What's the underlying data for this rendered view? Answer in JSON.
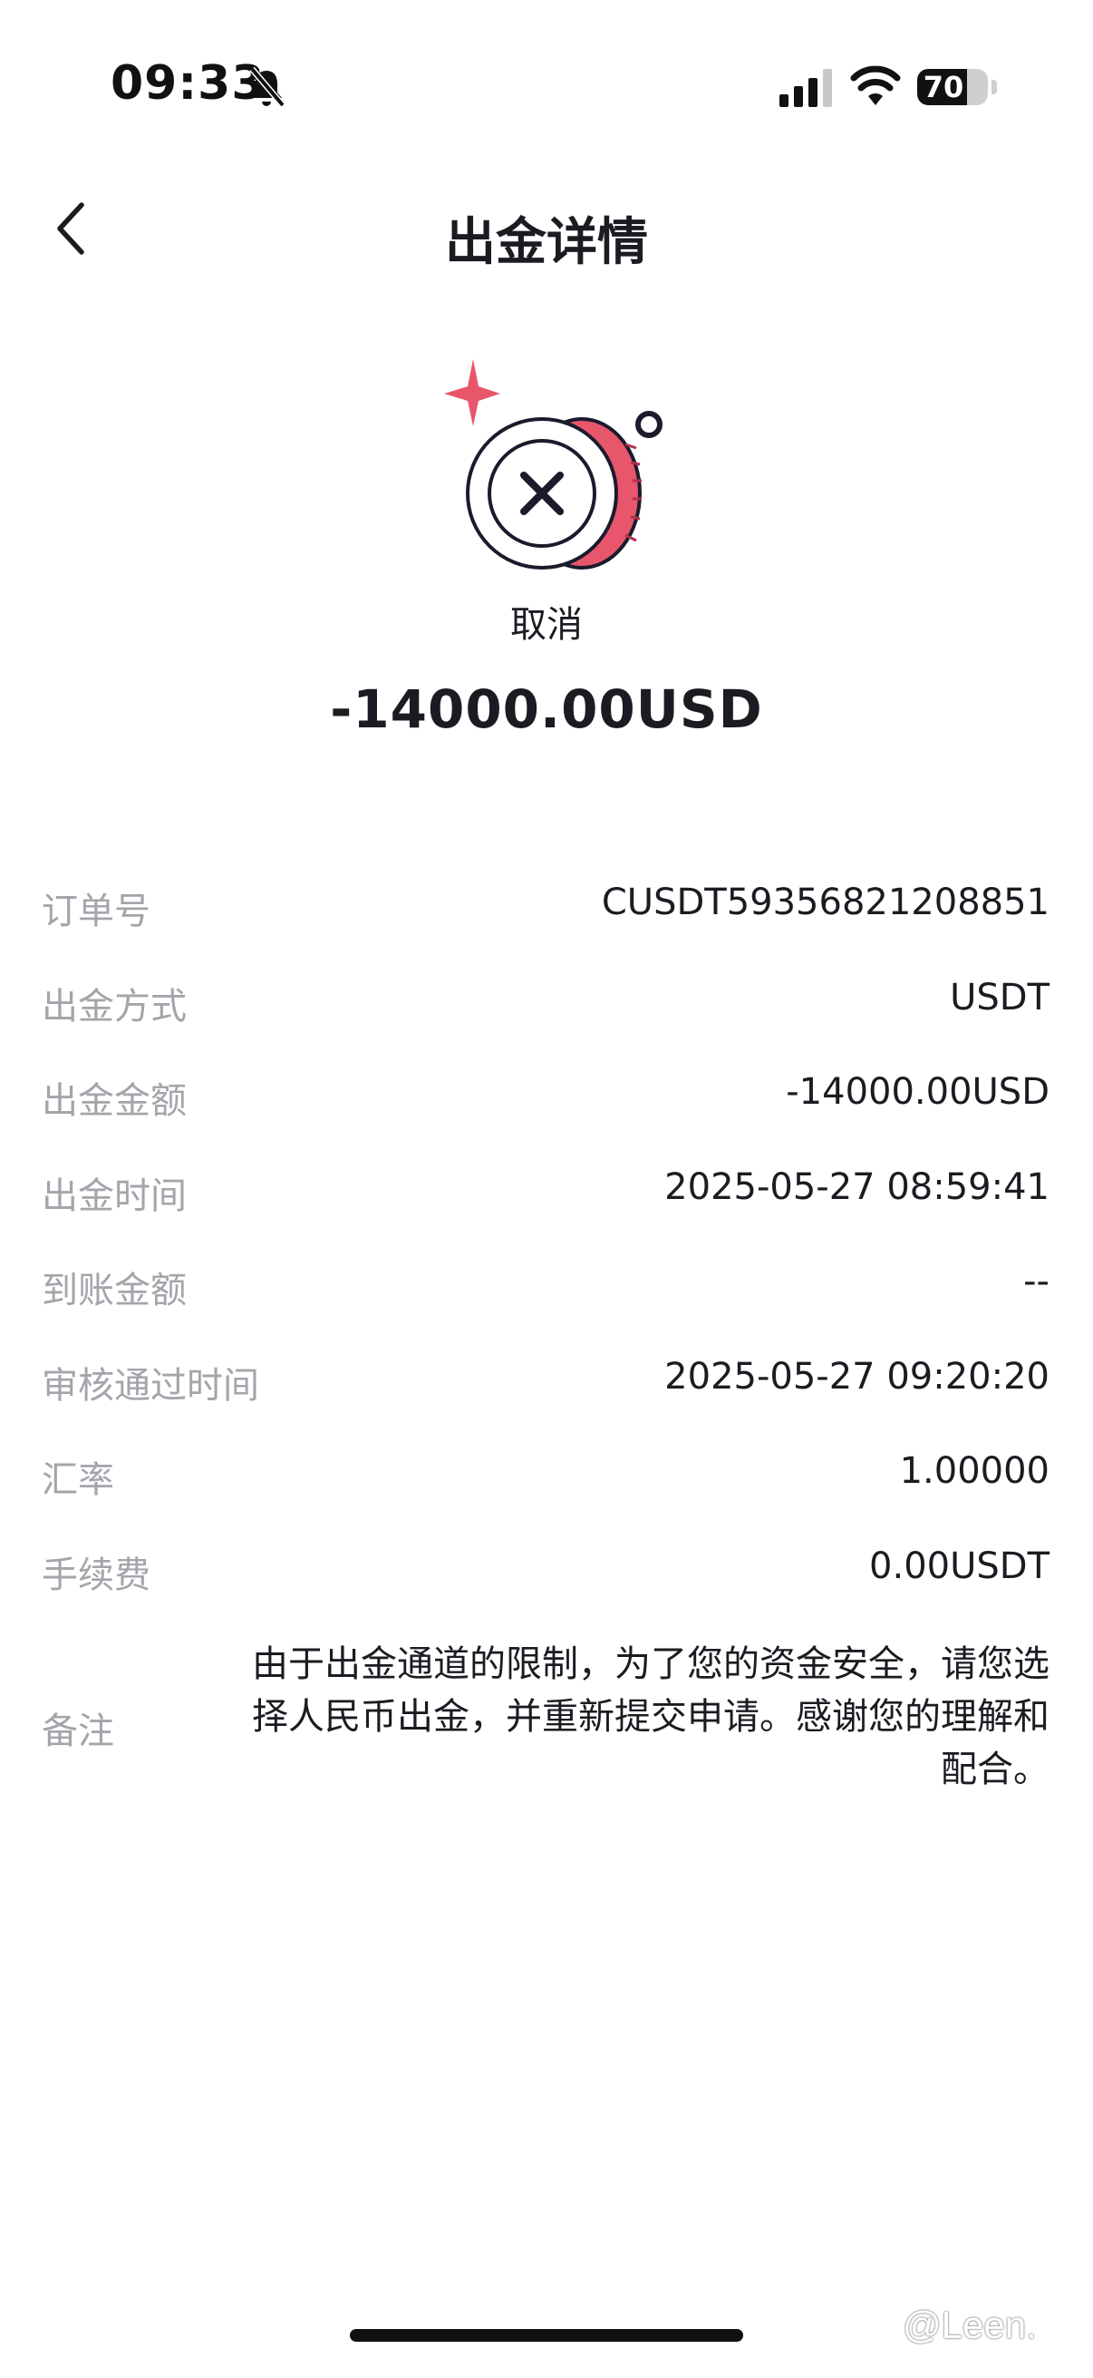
{
  "status_bar": {
    "time": "09:33",
    "battery": "70",
    "battery_level": 0.7,
    "icons": [
      "bell-slash-icon",
      "cellular-signal-icon",
      "wifi-icon",
      "battery-icon"
    ]
  },
  "nav": {
    "back_icon": "chevron-left-icon",
    "title": "出金详情"
  },
  "hero": {
    "icon": "cancelled-coin-icon",
    "status": "取消",
    "amount": "-14000.00USD",
    "colors": {
      "accent": "#e8566b",
      "dark": "#1b1b2e"
    }
  },
  "details": [
    {
      "label": "订单号",
      "value": "CUSDT59356821208851"
    },
    {
      "label": "出金方式",
      "value": "USDT"
    },
    {
      "label": "出金金额",
      "value": "-14000.00USD"
    },
    {
      "label": "出金时间",
      "value": "2025-05-27 08:59:41"
    },
    {
      "label": "到账金额",
      "value": "--"
    },
    {
      "label": "审核通过时间",
      "value": "2025-05-27 09:20:20"
    },
    {
      "label": "汇率",
      "value": "1.00000"
    },
    {
      "label": "手续费",
      "value": "0.00USDT"
    }
  ],
  "note": {
    "label": "备注",
    "text": "由于出金通道的限制，为了您的资金安全，请您选择人民币出金，并重新提交申请。感谢您的理解和配合。"
  },
  "watermark": "@Leen."
}
